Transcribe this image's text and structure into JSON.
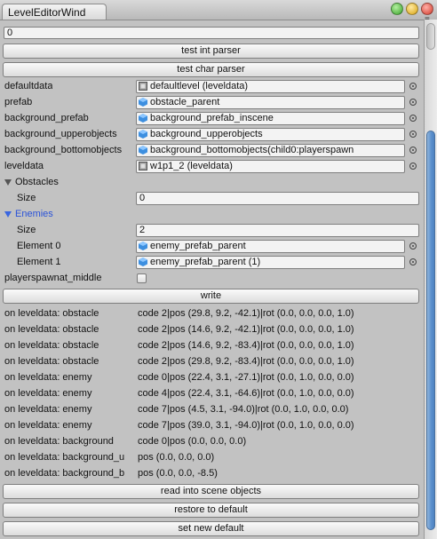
{
  "window": {
    "tab_title": "LevelEditorWind"
  },
  "top_field": {
    "value": "0"
  },
  "buttons": {
    "test_int": "test int parser",
    "test_char": "test char parser",
    "write": "write",
    "read_into_scene": "read into scene objects",
    "restore_default": "restore to default",
    "set_new_default": "set new default"
  },
  "fields": [
    {
      "label": "defaultdata",
      "value": "defaultlevel (leveldata)",
      "icon": "asset-icon"
    },
    {
      "label": "prefab",
      "value": "obstacle_parent",
      "icon": "prefab-cube-icon"
    },
    {
      "label": "background_prefab",
      "value": "background_prefab_inscene",
      "icon": "prefab-cube-icon"
    },
    {
      "label": "background_upperobjects",
      "value": "background_upperobjects",
      "icon": "prefab-cube-icon"
    },
    {
      "label": "background_bottomobjects",
      "value": "background_bottomobjects(child0:playerspawn",
      "icon": "prefab-cube-icon"
    },
    {
      "label": "leveldata",
      "value": "w1p1_2 (leveldata)",
      "icon": "asset-icon"
    }
  ],
  "obstacles": {
    "label": "Obstacles",
    "size_label": "Size",
    "size_value": "0"
  },
  "enemies": {
    "label": "Enemies",
    "size_label": "Size",
    "size_value": "2",
    "elements": [
      {
        "label": "Element 0",
        "value": "enemy_prefab_parent"
      },
      {
        "label": "Element 1",
        "value": "enemy_prefab_parent (1)"
      }
    ]
  },
  "playerspawn": {
    "label": "playerspawnat_middle",
    "checked": false
  },
  "log": [
    {
      "left": "on leveldata: obstacle",
      "right": "code 2|pos (29.8, 9.2, -42.1)|rot (0.0, 0.0, 0.0, 1.0)"
    },
    {
      "left": "on leveldata: obstacle",
      "right": "code 2|pos (14.6, 9.2, -42.1)|rot (0.0, 0.0, 0.0, 1.0)"
    },
    {
      "left": "on leveldata: obstacle",
      "right": "code 2|pos (14.6, 9.2, -83.4)|rot (0.0, 0.0, 0.0, 1.0)"
    },
    {
      "left": "on leveldata: obstacle",
      "right": "code 2|pos (29.8, 9.2, -83.4)|rot (0.0, 0.0, 0.0, 1.0)"
    },
    {
      "left": "on leveldata: enemy",
      "right": "code 0|pos (22.4, 3.1, -27.1)|rot (0.0, 1.0, 0.0, 0.0)"
    },
    {
      "left": "on leveldata: enemy",
      "right": "code 4|pos (22.4, 3.1, -64.6)|rot (0.0, 1.0, 0.0, 0.0)"
    },
    {
      "left": "on leveldata: enemy",
      "right": "code 7|pos (4.5, 3.1, -94.0)|rot (0.0, 1.0, 0.0, 0.0)"
    },
    {
      "left": "on leveldata: enemy",
      "right": "code 7|pos (39.0, 3.1, -94.0)|rot (0.0, 1.0, 0.0, 0.0)"
    },
    {
      "left": "on leveldata: background",
      "right": "code 0|pos (0.0, 0.0, 0.0)"
    },
    {
      "left": "on leveldata: background_u",
      "right": "pos (0.0, 0.0, 0.0)"
    },
    {
      "left": "on leveldata: background_b",
      "right": "pos (0.0, 0.0, -8.5)"
    }
  ]
}
